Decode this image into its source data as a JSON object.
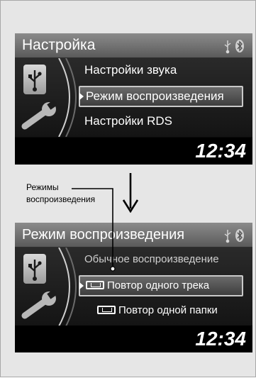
{
  "screen1": {
    "title": "Настройка",
    "items": [
      "Настройки звука",
      "Режим воспроизведения",
      "Настройки RDS"
    ],
    "selected_index": 1,
    "clock": "12:34"
  },
  "screen2": {
    "title": "Режим воспроизведения",
    "items": [
      "Обычное воспроизведение",
      "Повтор одного трека",
      "Повтор одной папки"
    ],
    "selected_index": 1,
    "clock": "12:34"
  },
  "annotation": {
    "line1": "Режимы",
    "line2": "воспроизведения"
  },
  "icons": [
    "usb-icon",
    "bluetooth-icon",
    "wrench-icon",
    "repeat-track-icon",
    "repeat-folder-icon",
    "down-arrow-icon"
  ]
}
